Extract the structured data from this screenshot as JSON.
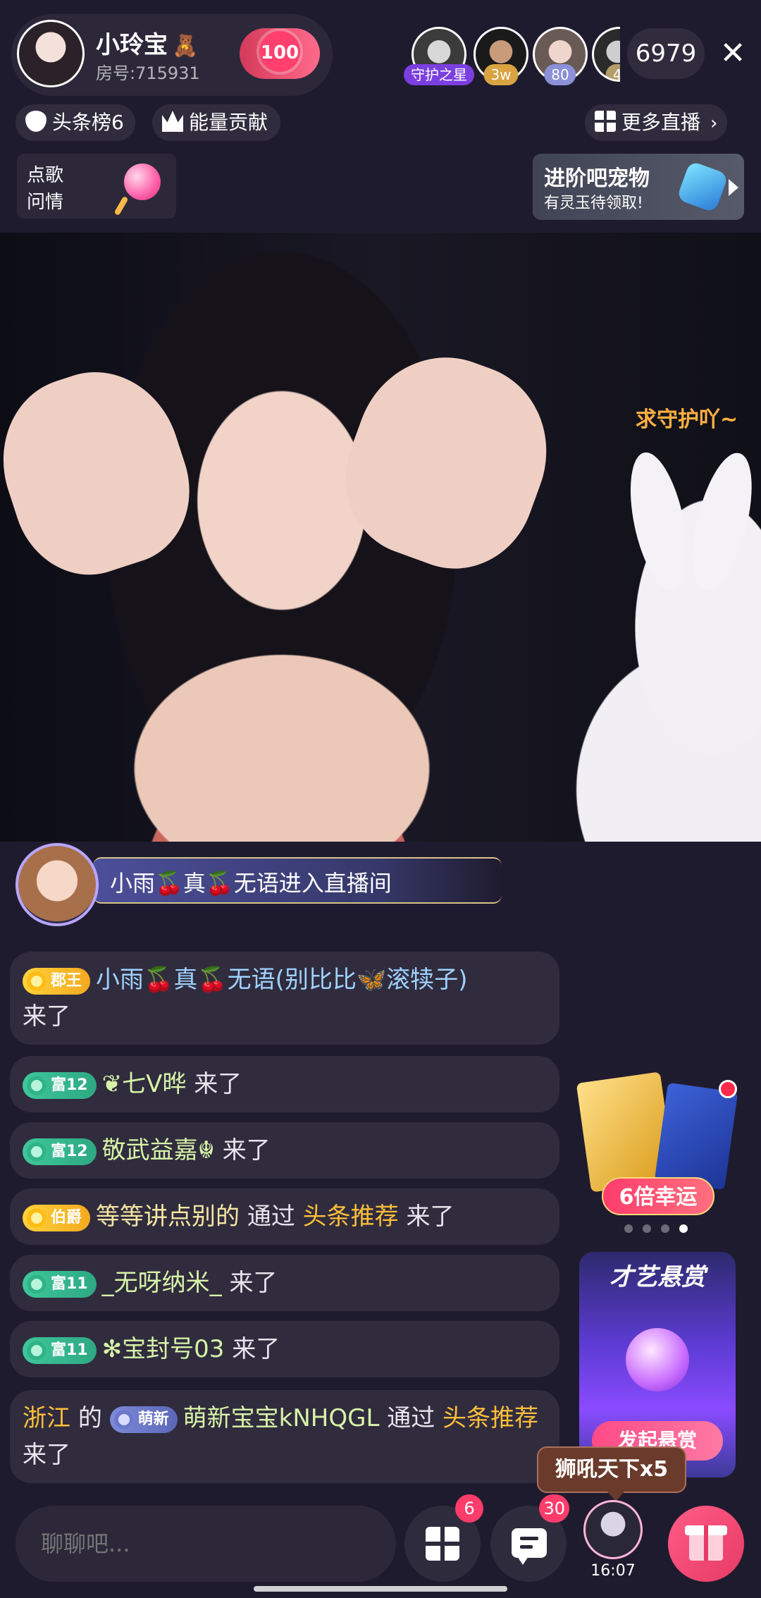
{
  "host": {
    "name": "小玲宝",
    "room_label": "房号:715931",
    "heart_count": "100"
  },
  "viewers": {
    "guardian_badge": "守护之星",
    "badge_2": "3w",
    "badge_3": "80",
    "badge_4": "4",
    "count": "6979"
  },
  "top_tags": {
    "headline_rank": "头条榜6",
    "energy": "能量贡献",
    "more_live": "更多直播"
  },
  "song_box": {
    "line1": "点歌",
    "line2": "问情"
  },
  "pet_banner": {
    "title": "进阶吧宠物",
    "subtitle": "有灵玉待领取!"
  },
  "video": {
    "caption": "求守护吖~"
  },
  "entry_banner": {
    "text": "小雨🍒真🍒无语进入直播间"
  },
  "messages": [
    {
      "badge": "郡王",
      "nick": "小雨🍒真🍒无语(别比比🦋滚犊子)",
      "tail": "来了"
    },
    {
      "badge": "富12",
      "nick": "❦七V晔",
      "tail": "来了"
    },
    {
      "badge": "富12",
      "nick": "敬武益嘉☬",
      "tail": "来了"
    },
    {
      "badge": "伯爵",
      "nick": "等等讲点别的",
      "mid": "通过",
      "source": "头条推荐",
      "tail": "来了"
    },
    {
      "badge": "富11",
      "nick": "_无呀纳米_",
      "tail": "来了"
    },
    {
      "badge": "富11",
      "nick": "✻宝封号03",
      "tail": "来了"
    },
    {
      "location": "浙江",
      "of": "的",
      "badge": "萌新",
      "nick": "萌新宝宝kNHQGL",
      "mid": "通过",
      "source": "头条推荐",
      "tail": "来了"
    }
  ],
  "lucky": {
    "label": "6倍幸运"
  },
  "reward": {
    "title": "才艺悬赏",
    "cta": "发起悬赏"
  },
  "tooltip": {
    "text": "狮吼天下x5"
  },
  "bottom": {
    "input_placeholder": "聊聊吧...",
    "apps_count": "6",
    "chat_count": "30",
    "timer": "16:07"
  },
  "colors": {
    "accent_pink": "#ff3c6a",
    "highlight_orange": "#ffbf3a",
    "background": "#1f1b2e"
  }
}
